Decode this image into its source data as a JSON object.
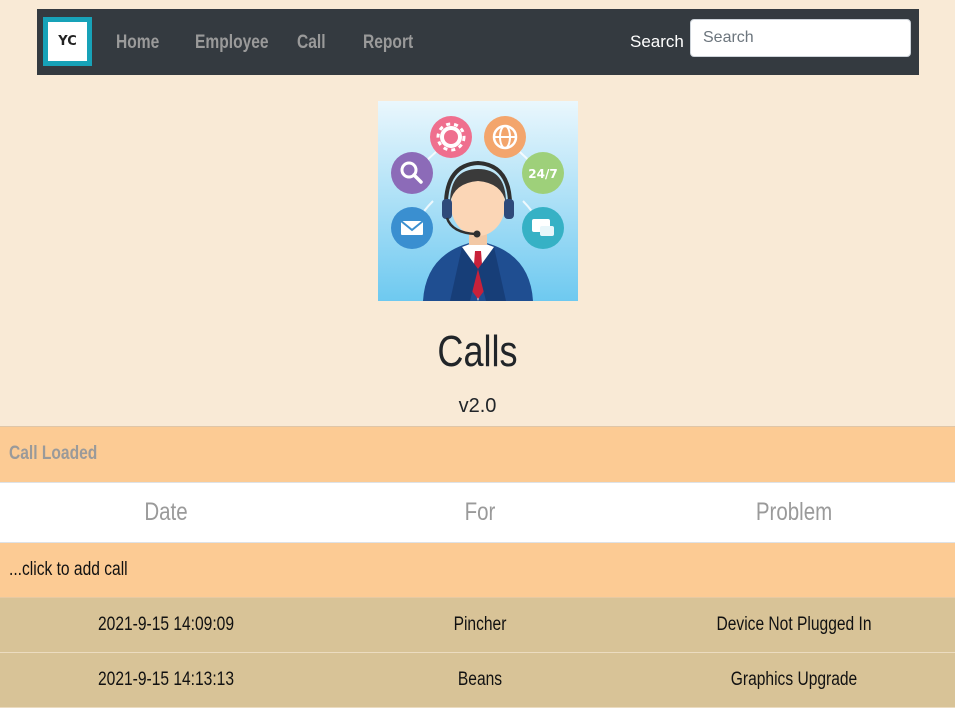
{
  "navbar": {
    "brand": "YC",
    "links": [
      "Home",
      "Employee",
      "Call",
      "Report"
    ],
    "search_label": "Search",
    "search_placeholder": "Search"
  },
  "hero": {
    "icon_labels": [
      "24/7"
    ]
  },
  "page": {
    "title": "Calls",
    "version": "v2.0"
  },
  "status": "Call Loaded",
  "table": {
    "headers": [
      "Date",
      "For",
      "Problem"
    ],
    "add_label": "...click to add call",
    "rows": [
      [
        "2021-9-15 14:09:09",
        "Pincher",
        "Device Not Plugged In"
      ],
      [
        "2021-9-15 14:13:13",
        "Beans",
        "Graphics Upgrade"
      ]
    ]
  },
  "colors": {
    "background": "#f9ead6",
    "navbar": "#343a40",
    "brand_border": "#17a2b8",
    "highlight_row": "#fccb94",
    "data_row": "#d8c397"
  }
}
